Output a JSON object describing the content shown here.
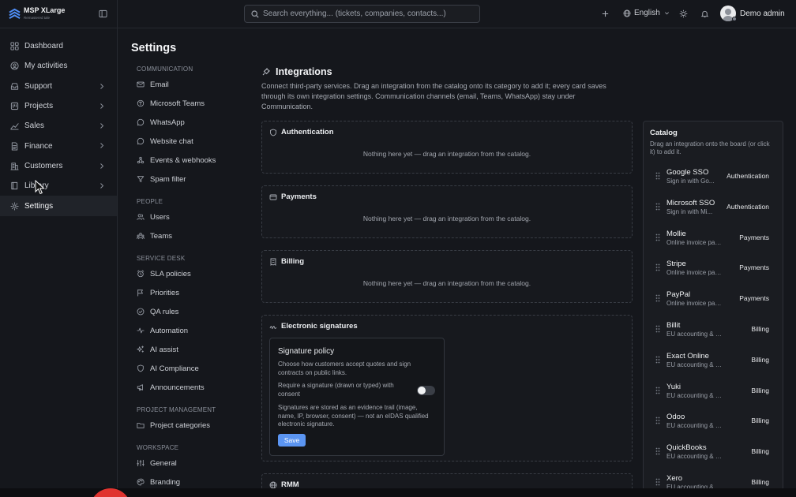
{
  "brand": {
    "name": "MSP XLarge",
    "sub": "Remastered tale"
  },
  "nav": {
    "items": [
      {
        "label": "Dashboard",
        "icon": "dashboard-icon",
        "chevron": false,
        "active": false
      },
      {
        "label": "My activities",
        "icon": "user-circle-icon",
        "chevron": false,
        "active": false
      },
      {
        "label": "Support",
        "icon": "inbox-icon",
        "chevron": true,
        "active": false
      },
      {
        "label": "Projects",
        "icon": "projects-icon",
        "chevron": true,
        "active": false
      },
      {
        "label": "Sales",
        "icon": "trend-icon",
        "chevron": true,
        "active": false
      },
      {
        "label": "Finance",
        "icon": "document-icon",
        "chevron": true,
        "active": false
      },
      {
        "label": "Customers",
        "icon": "building-icon",
        "chevron": true,
        "active": false
      },
      {
        "label": "Library",
        "icon": "book-icon",
        "chevron": true,
        "active": false
      },
      {
        "label": "Settings",
        "icon": "gear-icon",
        "chevron": false,
        "active": true
      }
    ]
  },
  "topbar": {
    "search_placeholder": "Search everything... (tickets, companies, contacts...)",
    "language": "English",
    "user": "Demo admin"
  },
  "settings": {
    "title": "Settings",
    "groups": [
      {
        "heading": "COMMUNICATION",
        "items": [
          {
            "label": "Email",
            "icon": "mail-icon"
          },
          {
            "label": "Microsoft Teams",
            "icon": "teams-icon"
          },
          {
            "label": "WhatsApp",
            "icon": "chat-bubble-icon"
          },
          {
            "label": "Website chat",
            "icon": "message-icon"
          },
          {
            "label": "Events & webhooks",
            "icon": "webhook-icon"
          },
          {
            "label": "Spam filter",
            "icon": "filter-icon"
          }
        ]
      },
      {
        "heading": "PEOPLE",
        "items": [
          {
            "label": "Users",
            "icon": "users-icon"
          },
          {
            "label": "Teams",
            "icon": "team-icon"
          }
        ]
      },
      {
        "heading": "SERVICE DESK",
        "items": [
          {
            "label": "SLA policies",
            "icon": "alarm-icon"
          },
          {
            "label": "Priorities",
            "icon": "flag-icon"
          },
          {
            "label": "QA rules",
            "icon": "check-circle-icon"
          },
          {
            "label": "Automation",
            "icon": "pulse-icon"
          },
          {
            "label": "AI assist",
            "icon": "sparkle-icon"
          },
          {
            "label": "AI Compliance",
            "icon": "shield-icon"
          },
          {
            "label": "Announcements",
            "icon": "megaphone-icon"
          }
        ]
      },
      {
        "heading": "PROJECT MANAGEMENT",
        "items": [
          {
            "label": "Project categories",
            "icon": "folder-icon"
          }
        ]
      },
      {
        "heading": "WORKSPACE",
        "items": [
          {
            "label": "General",
            "icon": "sliders-icon"
          },
          {
            "label": "Branding",
            "icon": "palette-icon"
          }
        ]
      }
    ]
  },
  "integrations": {
    "title": "Integrations",
    "description": "Connect third-party services. Drag an integration from the catalog onto its category to add it; every card saves through its own integration settings. Communication channels (email, Teams, WhatsApp) stay under Communication.",
    "categories": [
      {
        "name": "Authentication",
        "empty": "Nothing here yet — drag an integration from the catalog."
      },
      {
        "name": "Payments",
        "empty": "Nothing here yet — drag an integration from the catalog."
      },
      {
        "name": "Billing",
        "empty": "Nothing here yet — drag an integration from the catalog."
      },
      {
        "name": "Electronic signatures"
      },
      {
        "name": "RMM"
      }
    ],
    "signature_policy": {
      "title": "Signature policy",
      "description": "Choose how customers accept quotes and sign contracts on public links.",
      "toggle_label": "Require a signature (drawn or typed) with consent",
      "toggle_on": false,
      "note": "Signatures are stored as an evidence trail (image, name, IP, browser, consent) — not an eIDAS qualified electronic signature.",
      "save_label": "Save"
    }
  },
  "catalog": {
    "title": "Catalog",
    "subtitle": "Drag an integration onto the board (or click it) to add it.",
    "items": [
      {
        "name": "Google SSO",
        "desc": "Sign in with Go...",
        "tag": "Authentication"
      },
      {
        "name": "Microsoft SSO",
        "desc": "Sign in with Mi...",
        "tag": "Authentication"
      },
      {
        "name": "Mollie",
        "desc": "Online invoice paym...",
        "tag": "Payments"
      },
      {
        "name": "Stripe",
        "desc": "Online invoice paym...",
        "tag": "Payments"
      },
      {
        "name": "PayPal",
        "desc": "Online invoice paym...",
        "tag": "Payments"
      },
      {
        "name": "Billit",
        "desc": "EU accounting & e-invoi...",
        "tag": "Billing"
      },
      {
        "name": "Exact Online",
        "desc": "EU accounting & e-invoi...",
        "tag": "Billing"
      },
      {
        "name": "Yuki",
        "desc": "EU accounting & e-invoi...",
        "tag": "Billing"
      },
      {
        "name": "Odoo",
        "desc": "EU accounting & e-invoi...",
        "tag": "Billing"
      },
      {
        "name": "QuickBooks",
        "desc": "EU accounting & e-invoi...",
        "tag": "Billing"
      },
      {
        "name": "Xero",
        "desc": "EU accounting & e-invoi...",
        "tag": "Billing"
      }
    ]
  },
  "colors": {
    "accent": "#5b95f2",
    "background": "#15171c",
    "panel": "#1a1c21"
  }
}
